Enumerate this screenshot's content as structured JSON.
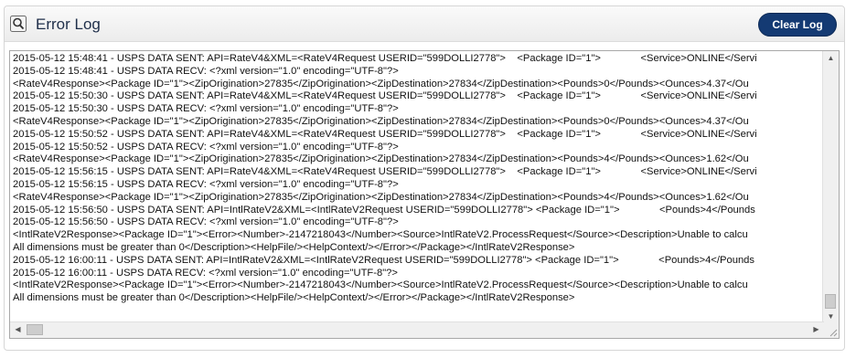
{
  "header": {
    "title": "Error Log",
    "icon": "search-log-icon",
    "clear_label": "Clear Log"
  },
  "log": {
    "lines": [
      "2015-05-12 15:48:41 - USPS DATA SENT: API=RateV4&XML=<RateV4Request USERID=\"599DOLLI2778\">    <Package ID=\"1\">              <Service>ONLINE</Servi",
      "2015-05-12 15:48:41 - USPS DATA RECV: <?xml version=\"1.0\" encoding=\"UTF-8\"?>",
      "<RateV4Response><Package ID=\"1\"><ZipOrigination>27835</ZipOrigination><ZipDestination>27834</ZipDestination><Pounds>0</Pounds><Ounces>4.37</Ou",
      "2015-05-12 15:50:30 - USPS DATA SENT: API=RateV4&XML=<RateV4Request USERID=\"599DOLLI2778\">    <Package ID=\"1\">              <Service>ONLINE</Servi",
      "2015-05-12 15:50:30 - USPS DATA RECV: <?xml version=\"1.0\" encoding=\"UTF-8\"?>",
      "<RateV4Response><Package ID=\"1\"><ZipOrigination>27835</ZipOrigination><ZipDestination>27834</ZipDestination><Pounds>0</Pounds><Ounces>4.37</Ou",
      "2015-05-12 15:50:52 - USPS DATA SENT: API=RateV4&XML=<RateV4Request USERID=\"599DOLLI2778\">    <Package ID=\"1\">              <Service>ONLINE</Servi",
      "2015-05-12 15:50:52 - USPS DATA RECV: <?xml version=\"1.0\" encoding=\"UTF-8\"?>",
      "<RateV4Response><Package ID=\"1\"><ZipOrigination>27835</ZipOrigination><ZipDestination>27834</ZipDestination><Pounds>4</Pounds><Ounces>1.62</Ou",
      "2015-05-12 15:56:15 - USPS DATA SENT: API=RateV4&XML=<RateV4Request USERID=\"599DOLLI2778\">    <Package ID=\"1\">              <Service>ONLINE</Servi",
      "2015-05-12 15:56:15 - USPS DATA RECV: <?xml version=\"1.0\" encoding=\"UTF-8\"?>",
      "<RateV4Response><Package ID=\"1\"><ZipOrigination>27835</ZipOrigination><ZipDestination>27834</ZipDestination><Pounds>4</Pounds><Ounces>1.62</Ou",
      "2015-05-12 15:56:50 - USPS DATA SENT: API=IntlRateV2&XML=<IntlRateV2Request USERID=\"599DOLLI2778\"> <Package ID=\"1\">              <Pounds>4</Pounds",
      "2015-05-12 15:56:50 - USPS DATA RECV: <?xml version=\"1.0\" encoding=\"UTF-8\"?>",
      "<IntlRateV2Response><Package ID=\"1\"><Error><Number>-2147218043</Number><Source>IntlRateV2.ProcessRequest</Source><Description>Unable to calcu",
      "All dimensions must be greater than 0</Description><HelpFile/><HelpContext/></Error></Package></IntlRateV2Response>",
      "2015-05-12 16:00:11 - USPS DATA SENT: API=IntlRateV2&XML=<IntlRateV2Request USERID=\"599DOLLI2778\"> <Package ID=\"1\">              <Pounds>4</Pounds",
      "2015-05-12 16:00:11 - USPS DATA RECV: <?xml version=\"1.0\" encoding=\"UTF-8\"?>",
      "<IntlRateV2Response><Package ID=\"1\"><Error><Number>-2147218043</Number><Source>IntlRateV2.ProcessRequest</Source><Description>Unable to calcu",
      "All dimensions must be greater than 0</Description><HelpFile/><HelpContext/></Error></Package></IntlRateV2Response>"
    ]
  },
  "scrollbars": {
    "up_arrow": "▲",
    "down_arrow": "▼",
    "left_arrow": "◀",
    "right_arrow": "▶"
  }
}
